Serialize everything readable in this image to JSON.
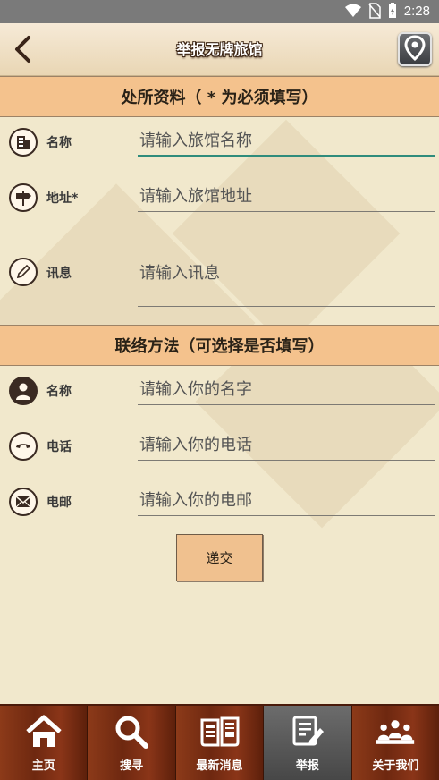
{
  "status_bar": {
    "time": "2:28"
  },
  "header": {
    "title": "举报无牌旅馆"
  },
  "section1": {
    "title": "处所资料（ * 为必须填写）",
    "fields": [
      {
        "label": "名称",
        "placeholder": "请输入旅馆名称",
        "icon": "building-icon"
      },
      {
        "label": "地址*",
        "placeholder": "请输入旅馆地址",
        "icon": "signpost-icon"
      },
      {
        "label": "讯息",
        "placeholder": "请输入讯息",
        "icon": "pencil-icon"
      }
    ]
  },
  "section2": {
    "title": "联络方法（可选择是否填写）",
    "fields": [
      {
        "label": "名称",
        "placeholder": "请输入你的名字",
        "icon": "person-icon"
      },
      {
        "label": "电话",
        "placeholder": "请输入你的电话",
        "icon": "phone-icon"
      },
      {
        "label": "电邮",
        "placeholder": "请输入你的电邮",
        "icon": "envelope-icon"
      }
    ]
  },
  "submit_label": "递交",
  "nav": {
    "items": [
      {
        "label": "主页",
        "icon": "home-icon"
      },
      {
        "label": "搜寻",
        "icon": "search-icon"
      },
      {
        "label": "最新消息",
        "icon": "newspaper-icon"
      },
      {
        "label": "举报",
        "icon": "report-icon",
        "active": true
      },
      {
        "label": "关于我们",
        "icon": "about-us-icon"
      }
    ]
  },
  "colors": {
    "section_header": "#f4c28d",
    "nav_background": "#7a2e12",
    "active_underline": "#2f8c7c"
  }
}
